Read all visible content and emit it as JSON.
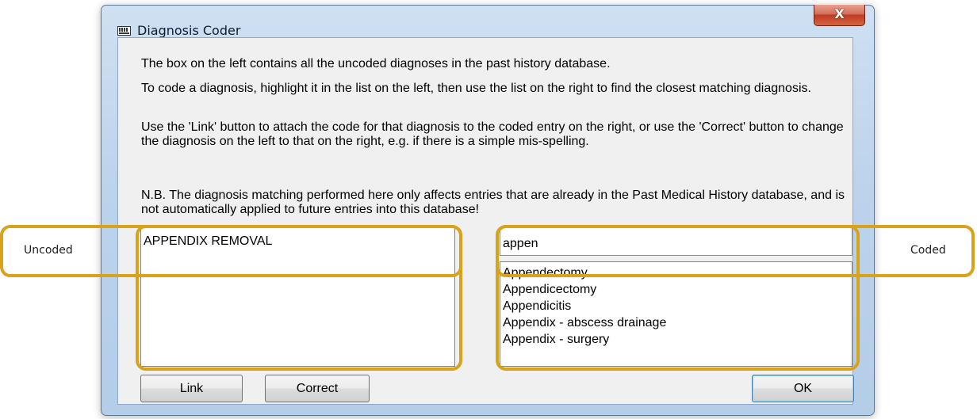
{
  "window": {
    "title": "Diagnosis Coder",
    "close_label": "X"
  },
  "instructions": [
    "The box on the left contains all the uncoded diagnoses in the past history database.",
    "To code a diagnosis, highlight it in the list on the left, then use the list on the right to find the closest matching diagnosis.",
    "Use the 'Link' button to attach the code for that diagnosis to the coded entry on the right, or use the 'Correct' button to change the diagnosis on the left to that on the right, e.g. if there is a simple mis-spelling.",
    "N.B. The diagnosis matching performed here only affects entries that are already in the Past Medical History database, and is not automatically applied to future entries into this database!"
  ],
  "uncoded_list": {
    "items": [
      "APPENDIX REMOVAL"
    ]
  },
  "search": {
    "value": "appen"
  },
  "coded_list": {
    "items": [
      "Appendectomy",
      "Appendicectomy",
      "Appendicitis",
      "Appendix - abscess drainage",
      "Appendix - surgery"
    ]
  },
  "buttons": {
    "link": "Link",
    "correct": "Correct",
    "ok": "OK"
  },
  "callouts": {
    "uncoded": "Uncoded",
    "coded": "Coded"
  },
  "colors": {
    "callout_border": "#d9a21b",
    "window_frame": "#bcd3ec",
    "close_button": "#c13b24"
  }
}
